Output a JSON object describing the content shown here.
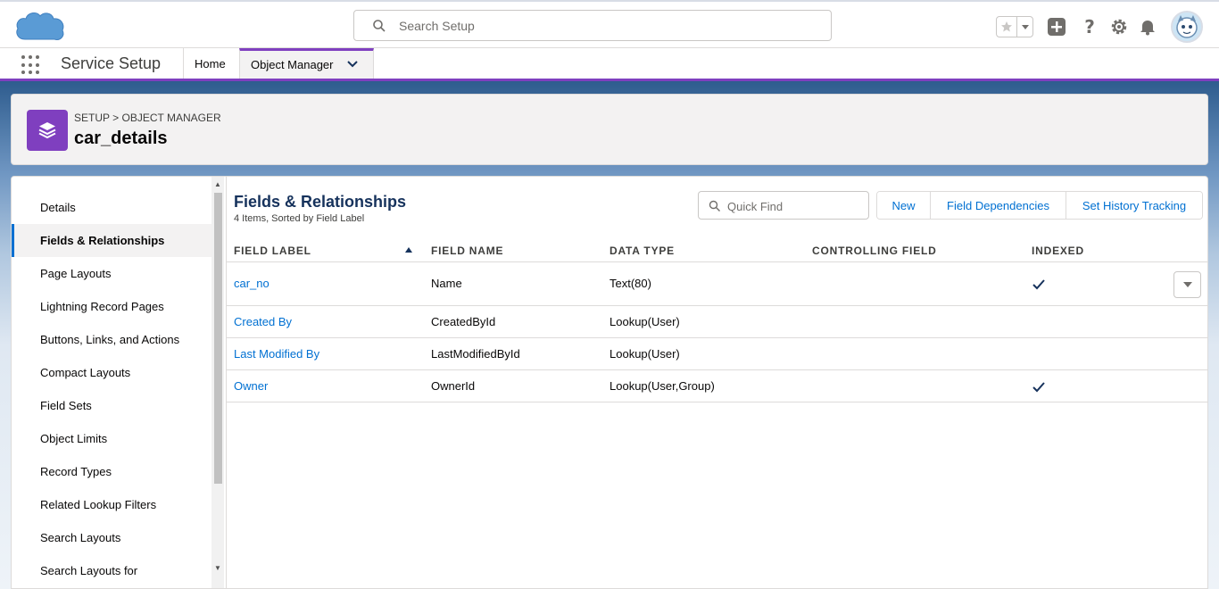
{
  "header": {
    "logo": "cloud-logo",
    "search_placeholder": "Search Setup",
    "icons": [
      "star-icon",
      "add-icon",
      "help-icon",
      "gear-icon",
      "bell-icon",
      "avatar"
    ]
  },
  "nav": {
    "app_name": "Service Setup",
    "tabs": [
      {
        "label": "Home"
      },
      {
        "label": "Object Manager"
      }
    ]
  },
  "object": {
    "breadcrumb_setup": "SETUP",
    "breadcrumb_sep": ">",
    "breadcrumb_om": "OBJECT MANAGER",
    "title": "car_details"
  },
  "sidebar": {
    "items": [
      {
        "label": "Details"
      },
      {
        "label": "Fields & Relationships"
      },
      {
        "label": "Page Layouts"
      },
      {
        "label": "Lightning Record Pages"
      },
      {
        "label": "Buttons, Links, and Actions"
      },
      {
        "label": "Compact Layouts"
      },
      {
        "label": "Field Sets"
      },
      {
        "label": "Object Limits"
      },
      {
        "label": "Record Types"
      },
      {
        "label": "Related Lookup Filters"
      },
      {
        "label": "Search Layouts"
      },
      {
        "label": "Search Layouts for"
      }
    ],
    "active_index": 1
  },
  "main": {
    "title": "Fields & Relationships",
    "subtitle": "4 Items, Sorted by Field Label",
    "quick_find_placeholder": "Quick Find",
    "buttons": [
      {
        "label": "New"
      },
      {
        "label": "Field Dependencies"
      },
      {
        "label": "Set History Tracking"
      }
    ],
    "columns": [
      "FIELD LABEL",
      "FIELD NAME",
      "DATA TYPE",
      "CONTROLLING FIELD",
      "INDEXED"
    ],
    "rows": [
      {
        "label": "car_no",
        "name": "Name",
        "type": "Text(80)",
        "controlling": "",
        "indexed": true
      },
      {
        "label": "Created By",
        "name": "CreatedById",
        "type": "Lookup(User)",
        "controlling": "",
        "indexed": false
      },
      {
        "label": "Last Modified By",
        "name": "LastModifiedById",
        "type": "Lookup(User)",
        "controlling": "",
        "indexed": false
      },
      {
        "label": "Owner",
        "name": "OwnerId",
        "type": "Lookup(User,Group)",
        "controlling": "",
        "indexed": true
      }
    ]
  },
  "colors": {
    "brand_purple": "#7f3fbf",
    "link_blue": "#0070d2",
    "title_navy": "#16325c"
  }
}
